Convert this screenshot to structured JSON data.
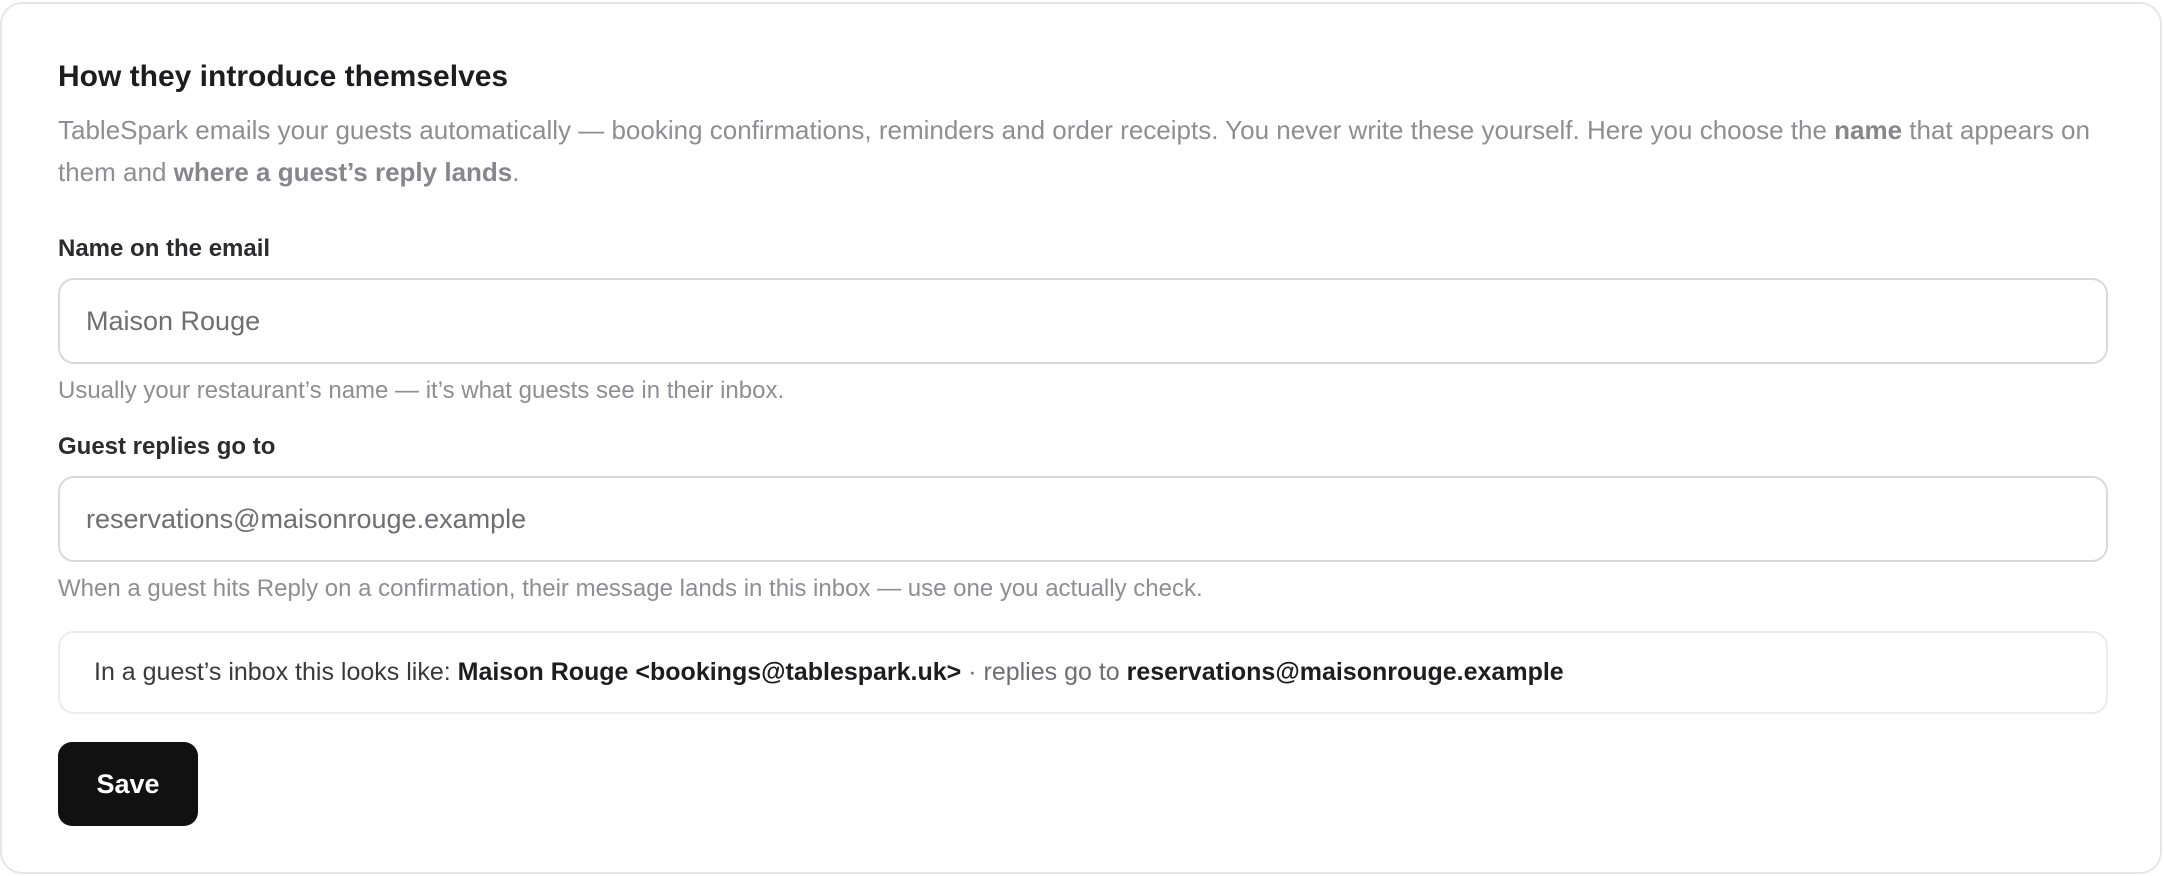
{
  "section": {
    "title": "How they introduce themselves",
    "intro": {
      "part1": "TableSpark emails your guests automatically — booking confirmations, reminders and order receipts. You never write these yourself. Here you choose the ",
      "bold1": "name",
      "part2": " that appears on them and ",
      "bold2": "where a guest’s reply lands",
      "part3": "."
    }
  },
  "fields": {
    "sender_name": {
      "label": "Name on the email",
      "value": "Maison Rouge",
      "hint": "Usually your restaurant’s name — it’s what guests see in their inbox."
    },
    "reply_to": {
      "label": "Guest replies go to",
      "value": "reservations@maisonrouge.example",
      "hint": "When a guest hits Reply on a confirmation, their message lands in this inbox — use one you actually check."
    }
  },
  "preview": {
    "prefix": "In a guest’s inbox this looks like: ",
    "from": "Maison Rouge <bookings@tablespark.uk>",
    "separator": " · replies go to ",
    "reply_to": "reservations@maisonrouge.example"
  },
  "actions": {
    "save_label": "Save"
  },
  "colors": {
    "primary_button": "#111111",
    "border": "#d9d9de",
    "muted_text": "#8e8e93"
  }
}
